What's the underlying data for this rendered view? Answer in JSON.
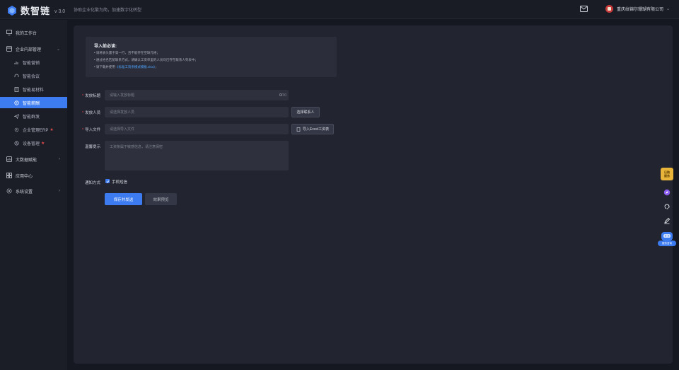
{
  "app": {
    "name": "数智链",
    "version": "v 3.0",
    "slogan": "协助企业化繁为简，加速数字化转型",
    "company": "重庆纹锦尔珊瑚有限公司",
    "accent_color": "#3d7cf0"
  },
  "sidebar": {
    "items": [
      {
        "label": "我的工作台",
        "icon": "monitor-icon"
      },
      {
        "label": "企业内部管理",
        "icon": "building-icon",
        "expanded": true
      },
      {
        "label": "智能营销",
        "icon": "chart-icon"
      },
      {
        "label": "智能会议",
        "icon": "headset-icon"
      },
      {
        "label": "智能易材料",
        "icon": "doc-icon"
      },
      {
        "label": "智能薪酬",
        "icon": "wallet-icon",
        "active": true
      },
      {
        "label": "智能群发",
        "icon": "send-icon"
      },
      {
        "label": "企业管理ERP",
        "icon": "gear-icon",
        "starred": true
      },
      {
        "label": "设备管理",
        "icon": "device-icon",
        "starred": true
      },
      {
        "label": "大数据赋能",
        "icon": "data-icon"
      },
      {
        "label": "应用中心",
        "icon": "grid-icon"
      },
      {
        "label": "系统设置",
        "icon": "settings-icon"
      }
    ]
  },
  "notice": {
    "title": "导入前必读:",
    "lines": [
      "• 请将表头置于第一行，且不能存在空缺元格；",
      "• 通过姓名匹配联系方式，请确认工资单里的人员均已存在联系人列表中；",
      "• 请下载并使用"
    ],
    "template_link": "《标准工资条模式模板.xlsx》",
    "link_suffix": "；"
  },
  "form": {
    "title_label": "发放标题",
    "title_placeholder": "请输入发放标题",
    "title_count": "0",
    "title_max": "/30",
    "people_label": "发放人员",
    "people_placeholder": "请选择发放人员",
    "people_button": "选择联系人",
    "file_label": "导入文件",
    "file_placeholder": "请选择导入文件",
    "file_button": "导入Excel工资表",
    "tip_label": "温馨提示",
    "tip_placeholder": "工资条属于敏感信息，请注意保密",
    "notify_label": "通知方式",
    "notify_option": "手机短信",
    "notify_checked": true,
    "submit_button": "保存并发送",
    "preview_button": "效果预览"
  },
  "float_tools": {
    "badge_line1": "已购",
    "badge_line2": "服务",
    "cs_label": "服务咨询"
  }
}
